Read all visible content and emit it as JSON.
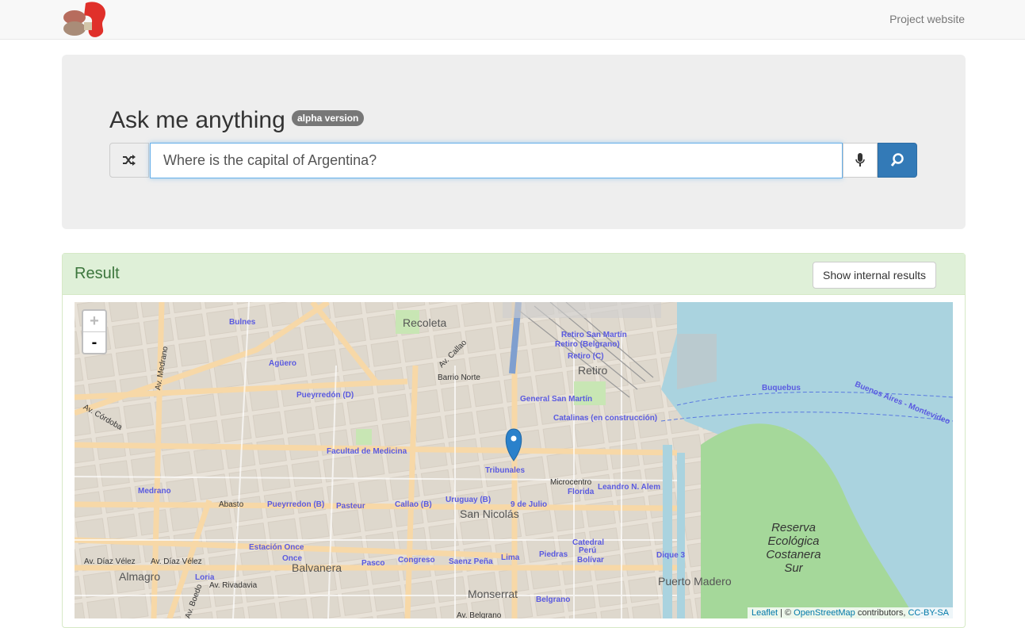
{
  "nav": {
    "project_link": "Project website"
  },
  "hero": {
    "title": "Ask me anything",
    "badge": "alpha version",
    "query_value": "Where is the capital of Argentina?"
  },
  "result": {
    "title": "Result",
    "internal_button": "Show internal results"
  },
  "map": {
    "zoom_in": "+",
    "zoom_out": "-",
    "attribution": {
      "leaflet": "Leaflet",
      "sep": " | © ",
      "osm": "OpenStreetMap",
      "contrib": " contributors, ",
      "license": "CC-BY-SA"
    },
    "labels": {
      "recoleta": "Recoleta",
      "bulnes": "Bulnes",
      "aguero": "Agüero",
      "medrano_av": "Av. Medrano",
      "cordoba": "Av. Córdoba",
      "pueyrredon_d": "Pueyrredón (D)",
      "facultad": "Facultad de Medicina",
      "barrio_norte": "Barrio Norte",
      "retiro": "Retiro",
      "retiro_sm": "Retiro San Martín",
      "retiro_b": "Retiro (Belgrano)",
      "retiro_c": "Retiro (C)",
      "gral_sm": "General San Martín",
      "catalinas": "Catalinas (en construcción)",
      "buquebus": "Buquebus",
      "bsas_mvd": "Buenos Aires - Montevideo",
      "tribunales": "Tribunales",
      "microcentro": "Microcentro",
      "leandro": "Leandro N. Alem",
      "florida": "Florida",
      "medrano": "Medrano",
      "abasto": "Abasto",
      "pueyrredon_b": "Pueyrredon (B)",
      "pasteur": "Pasteur",
      "callao_b": "Callao (B)",
      "uruguay_b": "Uruguay (B)",
      "nueve_julio": "9 de Julio",
      "san_nicolas": "San Nicolás",
      "catedral": "Catedral",
      "peru": "Perú",
      "estacion_once": "Estación Once",
      "once": "Once",
      "diaz_velez": "Av. Díaz Vélez",
      "almagro": "Almagro",
      "balvanera": "Balvanera",
      "pasco": "Pasco",
      "congreso": "Congreso",
      "saenz_pena": "Saenz Peña",
      "lima": "Lima",
      "piedras": "Piedras",
      "bolivar": "Bolívar",
      "loria": "Loria",
      "rivadavia": "Av. Rivadavia",
      "monserrat": "Monserrat",
      "belgrano": "Belgrano",
      "av_belgrano": "Av. Belgrano",
      "puerto_madero": "Puerto Madero",
      "reserva": "Reserva Ecológica Costanera Sur",
      "dique": "Dique 3",
      "callao": "Av. Callao",
      "boedo": "Av. Boedo"
    }
  }
}
